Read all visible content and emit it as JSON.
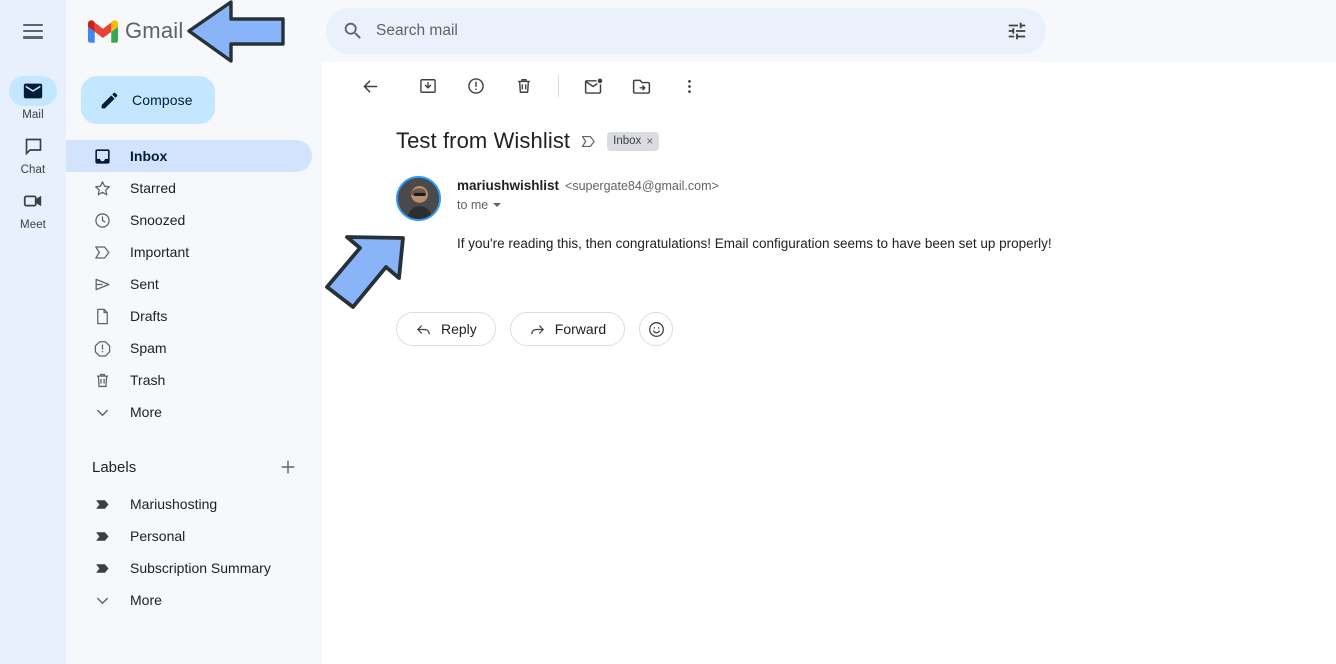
{
  "header": {
    "menu_icon": "hamburger-icon",
    "brand_label": "Gmail",
    "brand_logo_icon": "gmail-logo-icon"
  },
  "search": {
    "icon": "search-icon",
    "placeholder": "Search mail",
    "value": "",
    "options_icon": "search-options-icon"
  },
  "rail": {
    "items": [
      {
        "label": "Mail",
        "icon": "mail-icon",
        "active": true
      },
      {
        "label": "Chat",
        "icon": "chat-bubble-icon",
        "active": false
      },
      {
        "label": "Meet",
        "icon": "video-camera-icon",
        "active": false
      }
    ]
  },
  "sidebar": {
    "compose": {
      "label": "Compose",
      "icon": "pencil-icon"
    },
    "folders": [
      {
        "label": "Inbox",
        "icon": "inbox-icon",
        "active": true
      },
      {
        "label": "Starred",
        "icon": "star-icon",
        "active": false
      },
      {
        "label": "Snoozed",
        "icon": "clock-icon",
        "active": false
      },
      {
        "label": "Important",
        "icon": "important-marker-icon",
        "active": false
      },
      {
        "label": "Sent",
        "icon": "send-icon",
        "active": false
      },
      {
        "label": "Drafts",
        "icon": "document-icon",
        "active": false
      },
      {
        "label": "Spam",
        "icon": "spam-alert-icon",
        "active": false
      },
      {
        "label": "Trash",
        "icon": "trash-icon",
        "active": false
      },
      {
        "label": "More",
        "icon": "chevron-down-icon",
        "active": false
      }
    ],
    "labels_header": {
      "title": "Labels",
      "add_icon": "plus-icon"
    },
    "labels": [
      {
        "label": "Mariushosting",
        "icon": "label-tag-icon"
      },
      {
        "label": "Personal",
        "icon": "label-tag-icon"
      },
      {
        "label": "Subscription Summary",
        "icon": "label-tag-icon"
      },
      {
        "label": "More",
        "icon": "chevron-down-icon"
      }
    ]
  },
  "toolbar": {
    "buttons": [
      {
        "name": "back-button",
        "icon": "arrow-left-icon"
      },
      {
        "name": "archive-button",
        "icon": "archive-icon"
      },
      {
        "name": "report-spam-button",
        "icon": "report-spam-icon"
      },
      {
        "name": "delete-button",
        "icon": "trash-icon"
      },
      {
        "name": "mark-unread-button",
        "icon": "mark-unread-icon"
      },
      {
        "name": "move-to-button",
        "icon": "move-to-folder-icon"
      },
      {
        "name": "more-options-button",
        "icon": "more-vertical-icon"
      }
    ]
  },
  "email": {
    "subject": "Test from Wishlist",
    "important_icon": "important-marker-icon",
    "label_chip": {
      "text": "Inbox",
      "remove": "×"
    },
    "sender_name": "mariushwishlist",
    "sender_email": "<supergate84@gmail.com>",
    "recipient": "to me",
    "body": "If you're reading this, then congratulations! Email configuration seems to have been set up properly!",
    "avatar_name": "sender-avatar"
  },
  "actions": {
    "reply": {
      "label": "Reply",
      "icon": "reply-arrow-icon"
    },
    "forward": {
      "label": "Forward",
      "icon": "forward-arrow-icon"
    },
    "emoji": {
      "icon": "emoji-smiley-icon"
    }
  },
  "annotations": [
    {
      "name": "arrow-pointing-to-gmail-logo",
      "direction": "left"
    },
    {
      "name": "arrow-pointing-to-email-body",
      "direction": "up-right"
    }
  ],
  "colors": {
    "sidebar_bg": "#f6f8fc",
    "rail_bg": "#e8f0fe",
    "active_nav": "#d3e3fd",
    "compose_bg": "#c2e7ff",
    "search_bg": "#eaf1fb",
    "arrow_fill": "#8ab4f8",
    "arrow_stroke": "#263238"
  }
}
